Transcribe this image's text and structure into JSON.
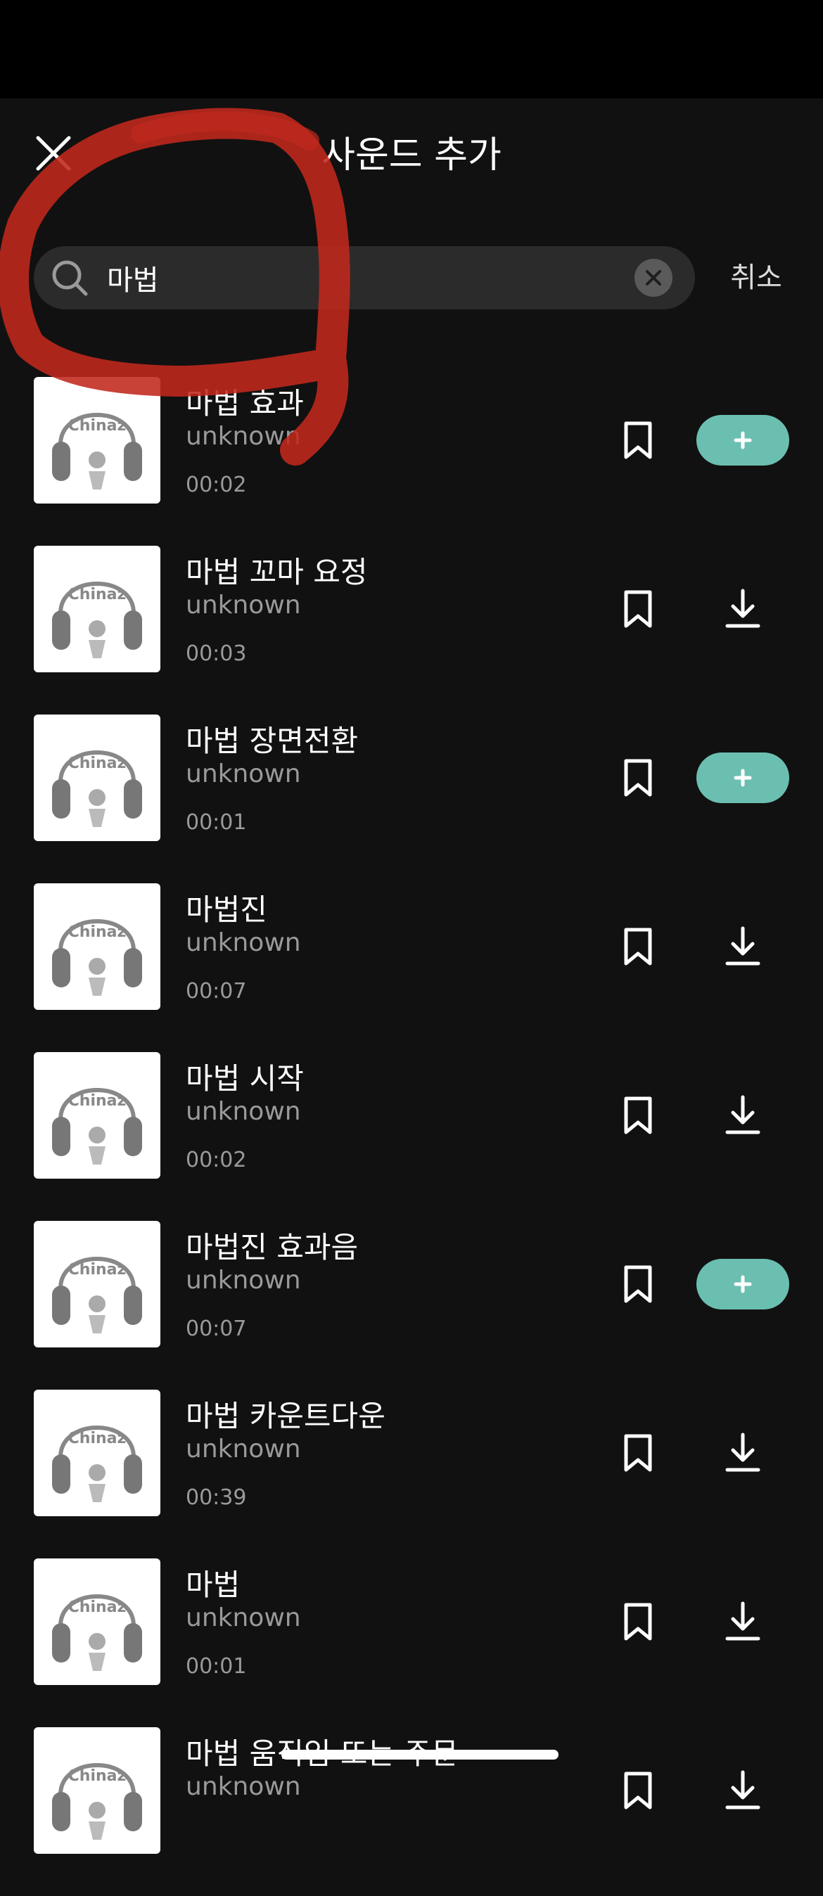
{
  "header": {
    "title": "사운드 추가",
    "close_icon": "close-icon"
  },
  "search": {
    "value": "마법",
    "icon": "search-icon",
    "clear_icon": "clear-icon",
    "cancel_label": "취소"
  },
  "colors": {
    "background": "#111111",
    "accent": "#6bbfb0",
    "secondary_text": "#9a9a9a",
    "annotation": "#c0281c"
  },
  "thumbnail": {
    "logo_text": "Chinaz"
  },
  "sounds": [
    {
      "title": "마법 효과",
      "artist": "unknown",
      "duration": "00:02",
      "action": "add"
    },
    {
      "title": "마법 꼬마 요정",
      "artist": "unknown",
      "duration": "00:03",
      "action": "download"
    },
    {
      "title": "마법 장면전환",
      "artist": "unknown",
      "duration": "00:01",
      "action": "add"
    },
    {
      "title": "마법진",
      "artist": "unknown",
      "duration": "00:07",
      "action": "download"
    },
    {
      "title": "마법 시작",
      "artist": "unknown",
      "duration": "00:02",
      "action": "download"
    },
    {
      "title": "마법진 효과음",
      "artist": "unknown",
      "duration": "00:07",
      "action": "add"
    },
    {
      "title": "마법 카운트다운",
      "artist": "unknown",
      "duration": "00:39",
      "action": "download"
    },
    {
      "title": "마법",
      "artist": "unknown",
      "duration": "00:01",
      "action": "download"
    },
    {
      "title": "마법 움직임 또는 주문",
      "artist": "unknown",
      "duration": "",
      "action": "download"
    }
  ]
}
